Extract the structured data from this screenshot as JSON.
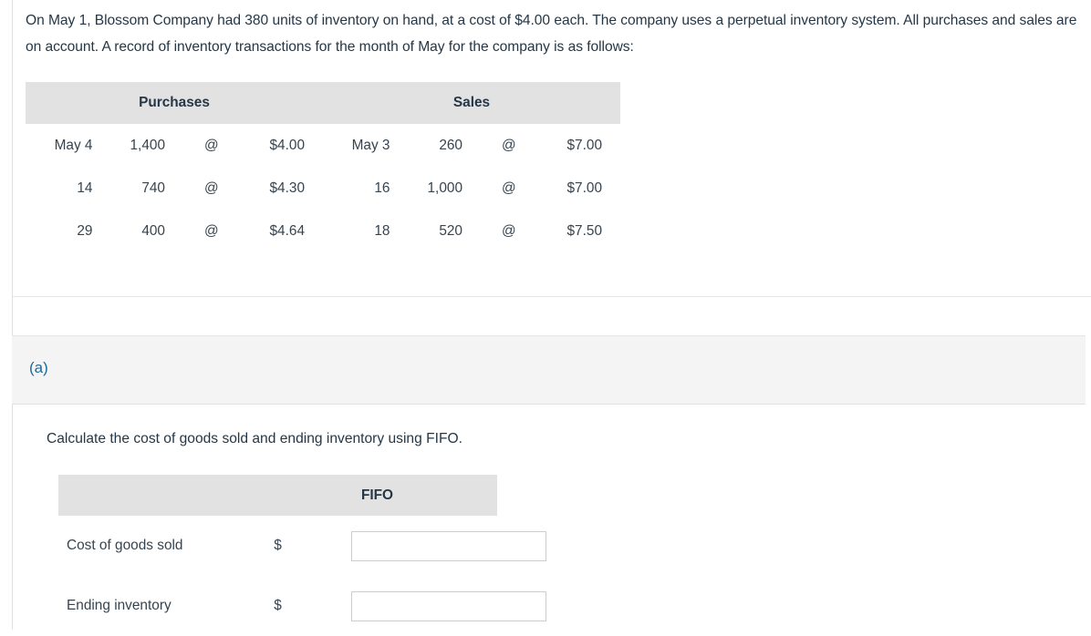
{
  "problem": {
    "statement": "On May 1, Blossom Company had 380 units of inventory on hand, at a cost of $4.00 each. The company uses a perpetual inventory system. All purchases and sales are on account. A record of inventory transactions for the month of May for the company is as follows:"
  },
  "transactions_table": {
    "headers": {
      "purchases": "Purchases",
      "sales": "Sales"
    },
    "rows": [
      {
        "purchase_date": "May 4",
        "purchase_units": "1,400",
        "purchase_at": "@",
        "purchase_price": "$4.00",
        "sale_date": "May 3",
        "sale_units": "260",
        "sale_at": "@",
        "sale_price": "$7.00"
      },
      {
        "purchase_date": "14",
        "purchase_units": "740",
        "purchase_at": "@",
        "purchase_price": "$4.30",
        "sale_date": "16",
        "sale_units": "1,000",
        "sale_at": "@",
        "sale_price": "$7.00"
      },
      {
        "purchase_date": "29",
        "purchase_units": "400",
        "purchase_at": "@",
        "purchase_price": "$4.64",
        "sale_date": "18",
        "sale_units": "520",
        "sale_at": "@",
        "sale_price": "$7.50"
      }
    ]
  },
  "part": {
    "label": "(a)",
    "label_color": "#1f6a96",
    "question": "Calculate the cost of goods sold and ending inventory using FIFO."
  },
  "answer_table": {
    "column_header": "FIFO",
    "rows": [
      {
        "label": "Cost of goods sold",
        "currency": "$",
        "value": "",
        "placeholder": ""
      },
      {
        "label": "Ending inventory",
        "currency": "$",
        "value": "",
        "placeholder": ""
      }
    ]
  },
  "colors": {
    "header_band": "#e2e2e2",
    "panel_background": "#f4f4f4",
    "text": "#253746",
    "accent": "#1f6a96",
    "border": "#e0e0e0"
  }
}
